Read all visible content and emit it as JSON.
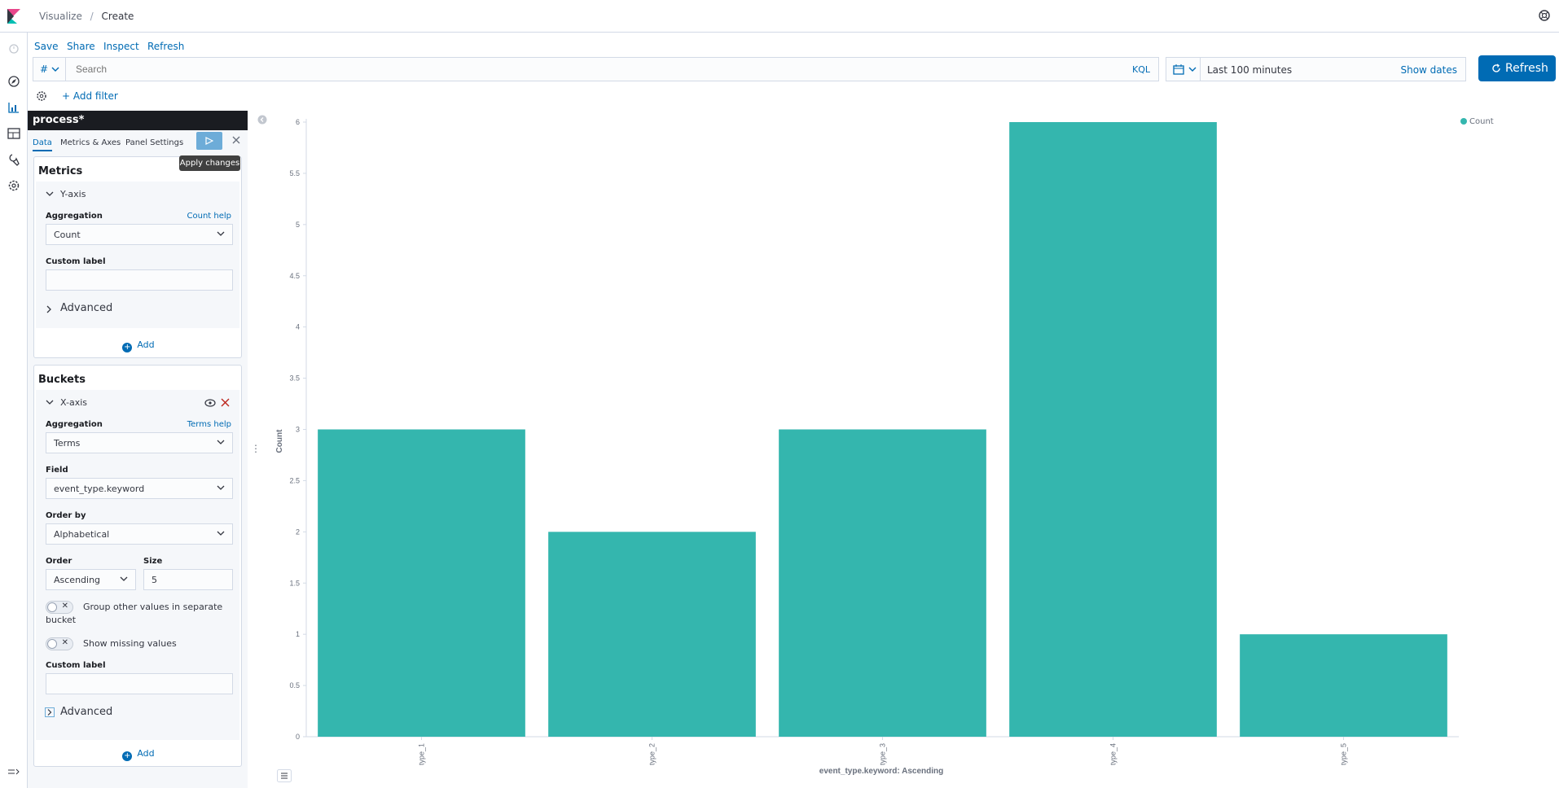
{
  "breadcrumbs": {
    "parent": "Visualize",
    "separator": "/",
    "current": "Create"
  },
  "menu": {
    "save": "Save",
    "share": "Share",
    "inspect": "Inspect",
    "refresh": "Refresh"
  },
  "query": {
    "prefix": "#",
    "placeholder": "Search",
    "language": "KQL"
  },
  "time": {
    "range": "Last 100 minutes",
    "show_dates": "Show dates",
    "refresh_label": "Refresh"
  },
  "filters": {
    "add_filter": "+ Add filter"
  },
  "sidebar": {
    "index_pattern": "process*",
    "tabs": [
      "Data",
      "Metrics & Axes",
      "Panel Settings"
    ],
    "apply_tooltip": "Apply changes",
    "metrics": {
      "title": "Metrics",
      "yaxis": {
        "label": "Y-axis",
        "aggregation_label": "Aggregation",
        "help_link": "Count help",
        "aggregation_value": "Count",
        "custom_label_label": "Custom label",
        "custom_label_value": "",
        "advanced": "Advanced"
      },
      "add": "Add"
    },
    "buckets": {
      "title": "Buckets",
      "xaxis": {
        "label": "X-axis",
        "aggregation_label": "Aggregation",
        "help_link": "Terms help",
        "aggregation_value": "Terms",
        "field_label": "Field",
        "field_value": "event_type.keyword",
        "order_by_label": "Order by",
        "order_by_value": "Alphabetical",
        "order_label": "Order",
        "order_value": "Ascending",
        "size_label": "Size",
        "size_value": "5",
        "group_other_label": "Group other values in separate bucket",
        "group_other_enabled": false,
        "missing_label": "Show missing values",
        "missing_enabled": false,
        "custom_label_label": "Custom label",
        "custom_label_value": "",
        "advanced": "Advanced"
      },
      "add": "Add"
    }
  },
  "colors": {
    "accent": "#006bb4",
    "bar": "#34b6ae",
    "header_dark": "#1a1c21"
  },
  "chart_data": {
    "type": "bar",
    "categories": [
      "type_1",
      "type_2",
      "type_3",
      "type_4",
      "type_5"
    ],
    "series": [
      {
        "name": "Count",
        "values": [
          3,
          2,
          3,
          6,
          1
        ]
      }
    ],
    "xlabel": "event_type.keyword: Ascending",
    "ylabel": "Count",
    "ylim": [
      0,
      6
    ],
    "yticks": [
      "0",
      "0.5",
      "1",
      "1.5",
      "2",
      "2.5",
      "3",
      "3.5",
      "4",
      "4.5",
      "5",
      "5.5",
      "6"
    ],
    "legend": "top-right",
    "grid": false
  }
}
